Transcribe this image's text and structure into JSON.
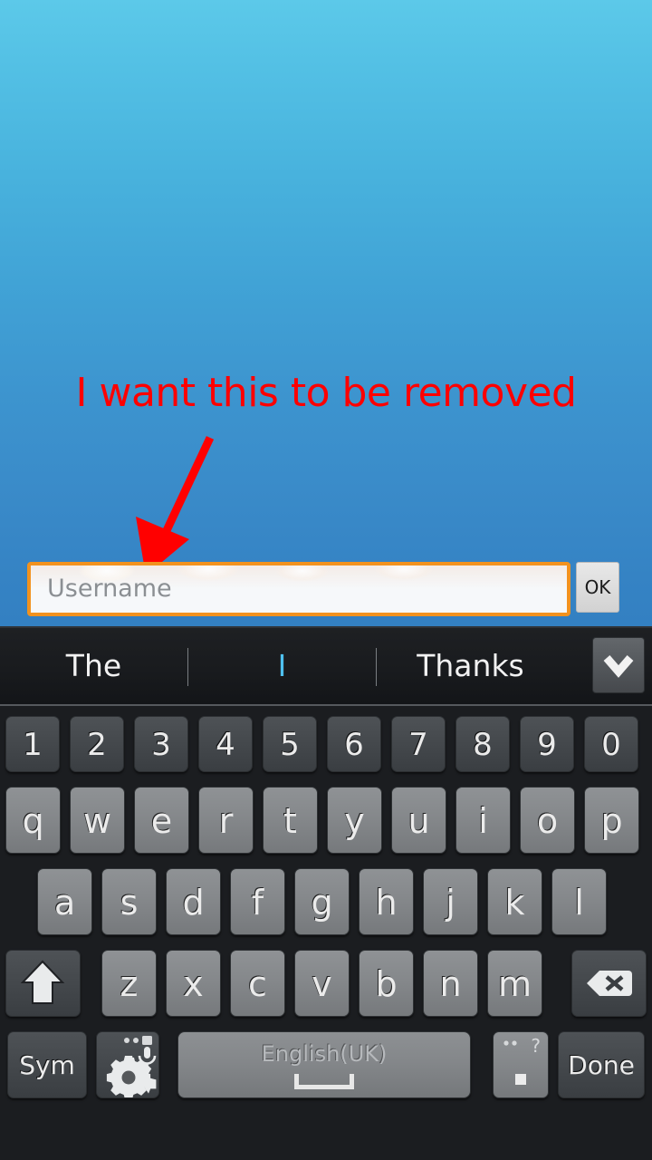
{
  "wallpaper": {
    "gradient_top": "#5cc9e9",
    "gradient_bottom": "#3380c2"
  },
  "annotation": {
    "text": "I want this to be removed",
    "color": "#ff0000",
    "arrow_icon": "down-arrow-icon"
  },
  "input_row": {
    "username": {
      "value": "",
      "placeholder": "Username",
      "border_color": "#f2921e"
    },
    "ok_label": "OK"
  },
  "keyboard": {
    "language": "English(UK)",
    "suggestions": [
      {
        "label": "The",
        "current": false
      },
      {
        "label": "I",
        "current": true
      },
      {
        "label": "Thanks",
        "current": false
      }
    ],
    "expand_icon": "chevron-down-icon",
    "rows": {
      "numbers": [
        "1",
        "2",
        "3",
        "4",
        "5",
        "6",
        "7",
        "8",
        "9",
        "0"
      ],
      "top": [
        "q",
        "w",
        "e",
        "r",
        "t",
        "y",
        "u",
        "i",
        "o",
        "p"
      ],
      "home": [
        "a",
        "s",
        "d",
        "f",
        "g",
        "h",
        "j",
        "k",
        "l"
      ],
      "bottom": [
        "z",
        "x",
        "c",
        "v",
        "b",
        "n",
        "m"
      ]
    },
    "shift_icon": "shift-arrow-icon",
    "backspace_icon": "backspace-icon",
    "sym_label": "Sym",
    "settings_icon": "gear-mic-icon",
    "period_label": ".",
    "period_alt": "?",
    "done_label": "Done"
  }
}
